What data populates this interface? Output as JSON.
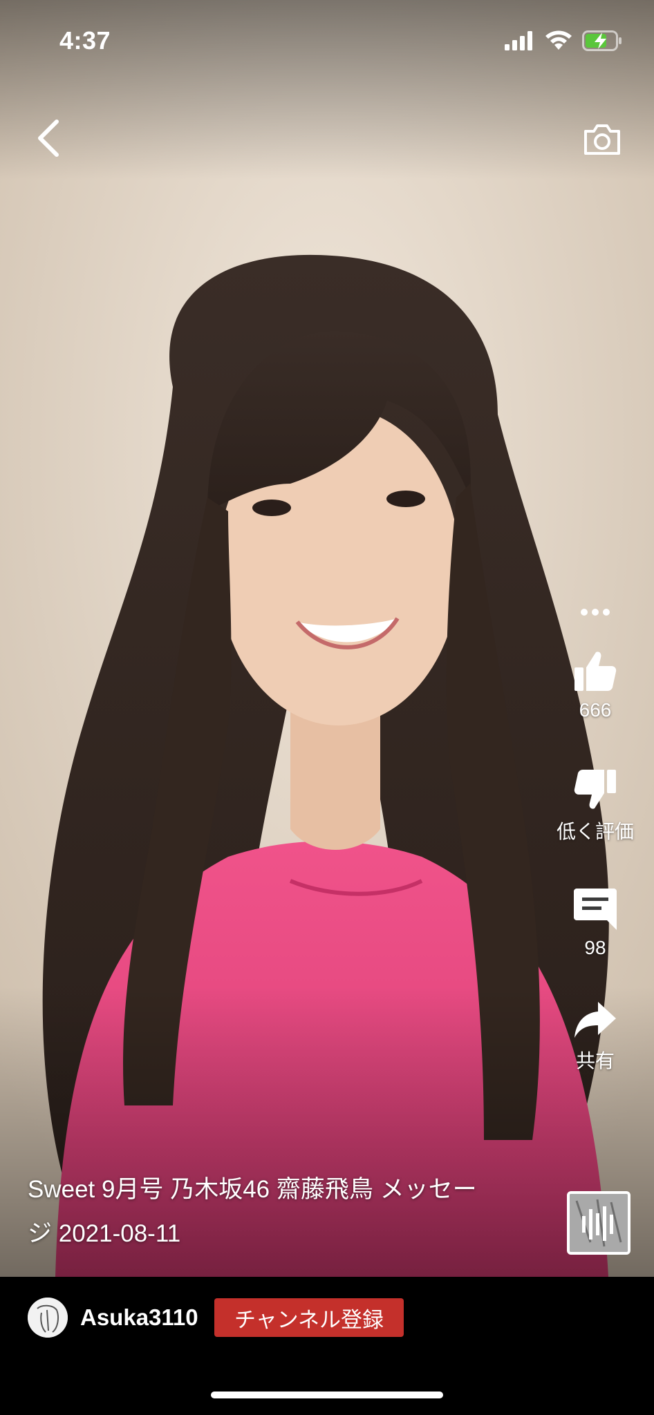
{
  "status_bar": {
    "time": "4:37",
    "icons": [
      "cellular-signal-icon",
      "wifi-icon",
      "battery-charging-icon"
    ]
  },
  "top_bar": {
    "back_icon": "chevron-left-icon",
    "camera_icon": "camera-icon"
  },
  "actions": {
    "more_icon": "more-horizontal-icon",
    "like": {
      "icon": "thumbs-up-icon",
      "count": "666"
    },
    "dislike": {
      "icon": "thumbs-down-icon",
      "label": "低く評価"
    },
    "comments": {
      "icon": "comment-icon",
      "count": "98"
    },
    "share": {
      "icon": "share-icon",
      "label": "共有"
    }
  },
  "video": {
    "title_line1": "Sweet 9月号 乃木坂46 齋藤飛鳥 メッセー",
    "title_line2": "ジ 2021-08-11"
  },
  "channel": {
    "name": "Asuka3110",
    "subscribe_label": "チャンネル登録"
  },
  "colors": {
    "subscribe": "#c4302b",
    "background": "#000000",
    "battery_charge": "#5ac63b"
  }
}
